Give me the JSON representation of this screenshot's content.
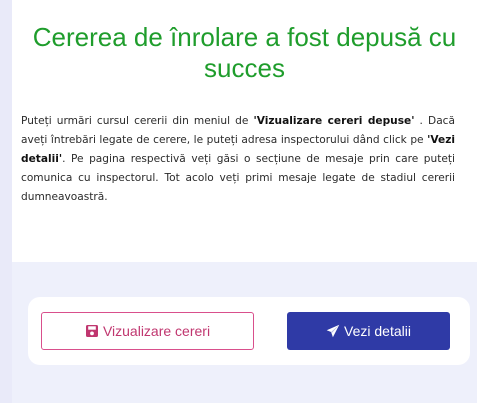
{
  "message": {
    "title": "Cererea de înrolare a fost depusă cu succes",
    "body": {
      "part1": "Puteți urmări cursul cererii din meniul de ",
      "bold1": "'Vizualizare cereri depuse'",
      "part2": " . Dacă aveți întrebări legate de cerere, le puteți adresa inspectorului dând click pe ",
      "bold2": "'Vezi detalii'",
      "part3": ". Pe pagina respectivă veți găsi o secțiune de mesaje prin care puteți comunica cu inspectorul. Tot acolo veți primi mesaje legate de stadiul cererii dumneavoastră."
    }
  },
  "actions": {
    "view_requests": {
      "label": "Vizualizare cereri",
      "icon": "save-icon"
    },
    "view_details": {
      "label": "Vezi detalii",
      "icon": "paper-plane-icon"
    }
  },
  "colors": {
    "title": "#1f9d2c",
    "view_button": "#d94f8c",
    "details_button": "#2f3aa6",
    "background": "#e9eaf9"
  }
}
